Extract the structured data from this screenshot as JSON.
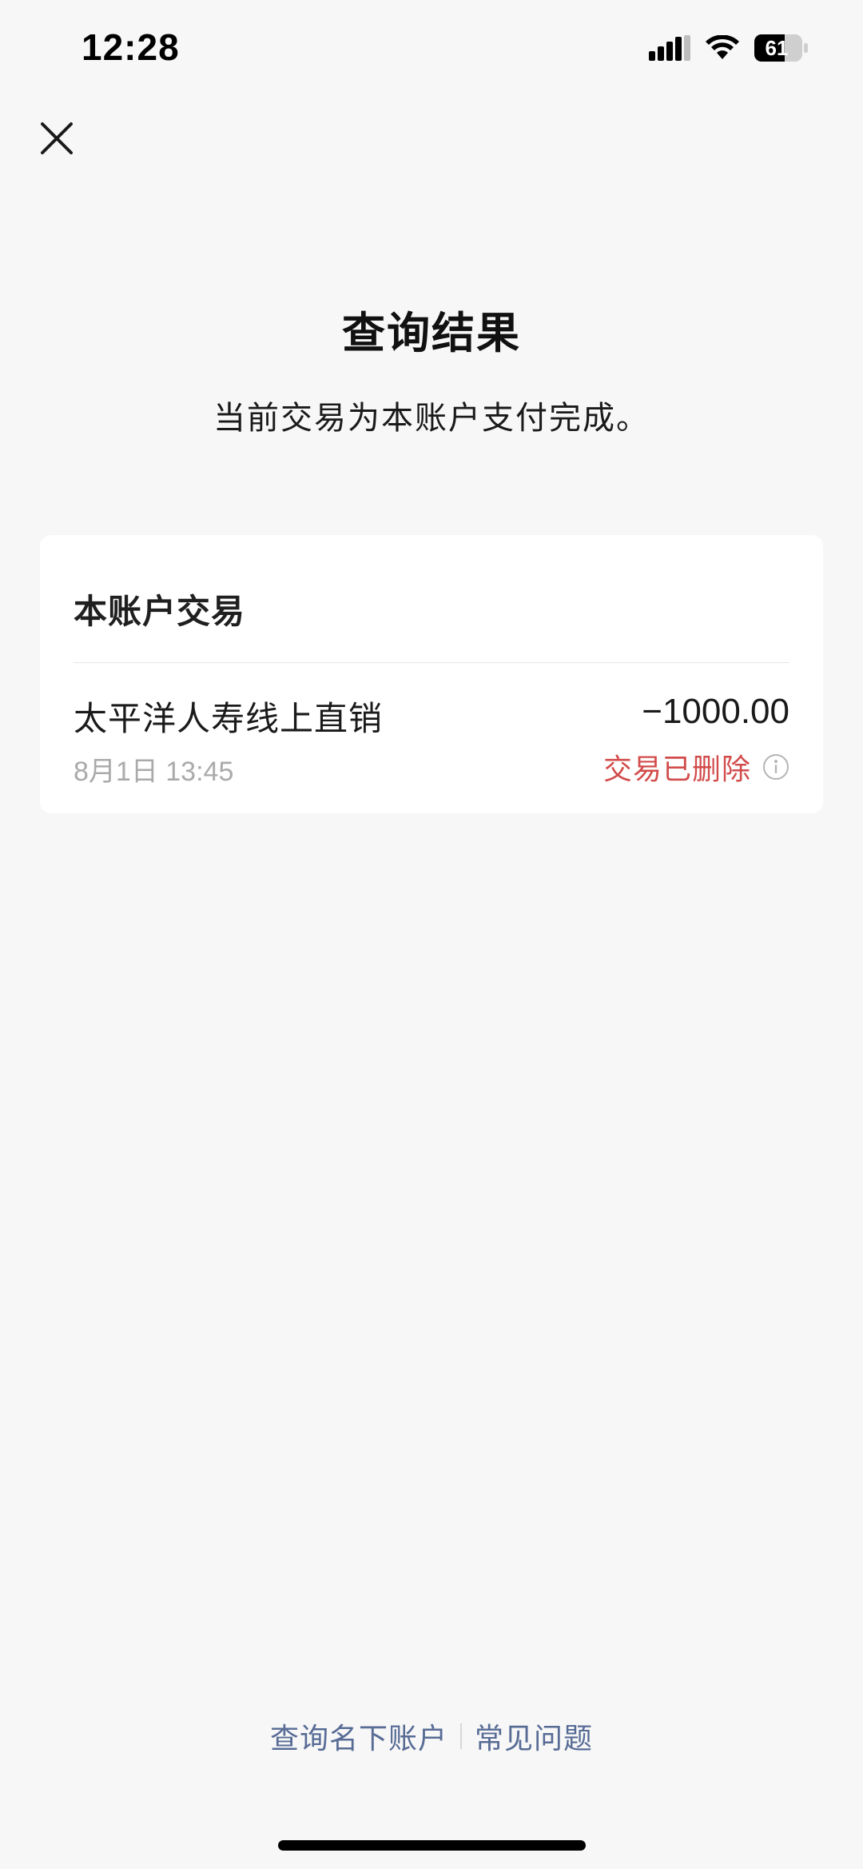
{
  "status_bar": {
    "time": "12:28",
    "battery_level": "61",
    "icons": [
      "signal-icon",
      "wifi-icon",
      "battery-icon"
    ]
  },
  "header": {
    "close_icon": "close-icon",
    "title": "查询结果",
    "subtitle": "当前交易为本账户支付完成。"
  },
  "card": {
    "title": "本账户交易",
    "transaction": {
      "merchant": "太平洋人寿线上直销",
      "time": "8月1日 13:45",
      "amount": "−1000.00",
      "status": "交易已删除",
      "status_icon": "info-icon"
    }
  },
  "footer": {
    "links": [
      "查询名下账户",
      "常见问题"
    ]
  },
  "colors": {
    "background": "#f7f7f7",
    "card": "#ffffff",
    "status_red": "#d24b4b",
    "link_blue": "#576b95",
    "muted_gray": "#aaaaaa"
  }
}
